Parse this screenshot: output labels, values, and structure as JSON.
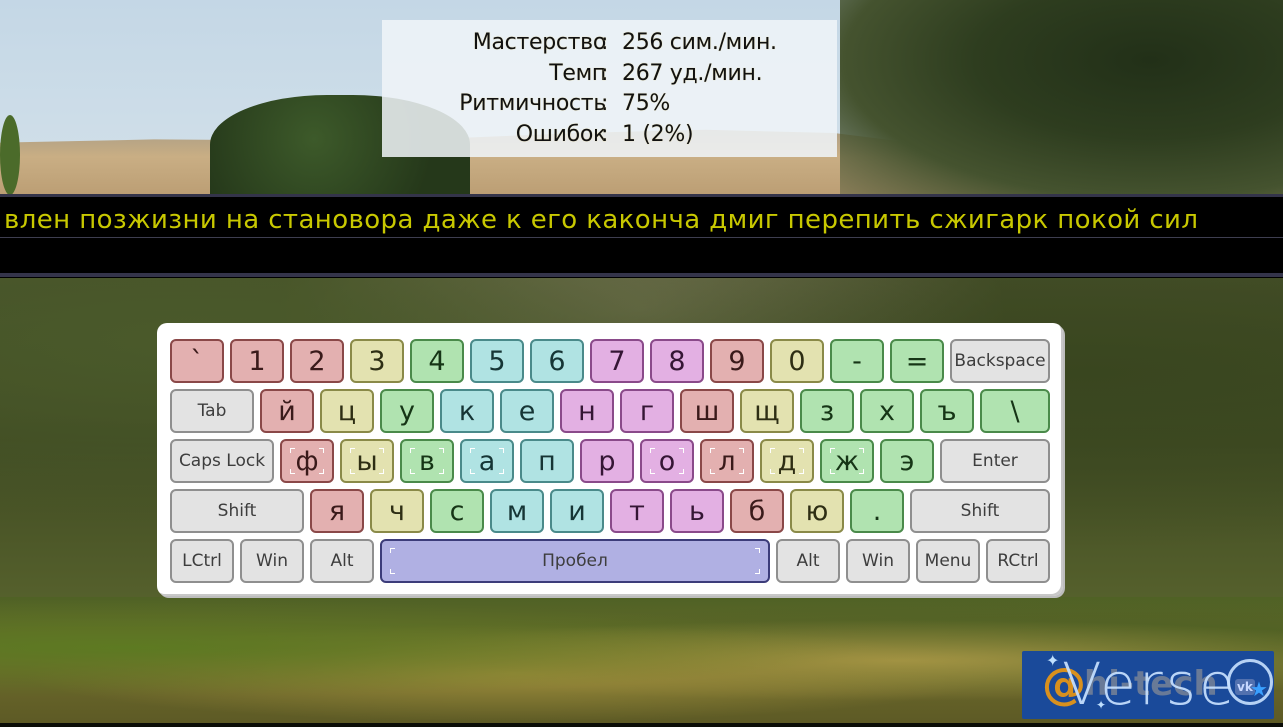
{
  "stats": [
    {
      "label": "Мастерство",
      "separator": ":",
      "value": "256 сим./мин."
    },
    {
      "label": "Темп",
      "separator": ":",
      "value": "267 уд./мин."
    },
    {
      "label": "Ритмичность",
      "separator": ":",
      "value": "75%"
    },
    {
      "label": "Ошибок",
      "separator": ":",
      "value": "1 (2%)"
    }
  ],
  "exercise": {
    "text": "влен позжизни на становора даже к его каконча дмиг перепить сжигарк покой сил",
    "typed": "",
    "text_color": "#c8c800"
  },
  "keyboard": {
    "rows": [
      [
        {
          "label": "`",
          "color": "red"
        },
        {
          "label": "1",
          "color": "red"
        },
        {
          "label": "2",
          "color": "red"
        },
        {
          "label": "3",
          "color": "yellow"
        },
        {
          "label": "4",
          "color": "green"
        },
        {
          "label": "5",
          "color": "cyan"
        },
        {
          "label": "6",
          "color": "cyan"
        },
        {
          "label": "7",
          "color": "purple"
        },
        {
          "label": "8",
          "color": "purple"
        },
        {
          "label": "9",
          "color": "red"
        },
        {
          "label": "0",
          "color": "yellow"
        },
        {
          "label": "-",
          "color": "green"
        },
        {
          "label": "=",
          "color": "green"
        },
        {
          "label": "Backspace",
          "color": "gray"
        }
      ],
      [
        {
          "label": "Tab",
          "color": "gray"
        },
        {
          "label": "й",
          "color": "red"
        },
        {
          "label": "ц",
          "color": "yellow"
        },
        {
          "label": "у",
          "color": "green"
        },
        {
          "label": "к",
          "color": "cyan"
        },
        {
          "label": "е",
          "color": "cyan"
        },
        {
          "label": "н",
          "color": "purple"
        },
        {
          "label": "г",
          "color": "purple"
        },
        {
          "label": "ш",
          "color": "red"
        },
        {
          "label": "щ",
          "color": "yellow"
        },
        {
          "label": "з",
          "color": "green"
        },
        {
          "label": "х",
          "color": "green"
        },
        {
          "label": "ъ",
          "color": "green"
        },
        {
          "label": "\\",
          "color": "green"
        }
      ],
      [
        {
          "label": "Caps Lock",
          "color": "gray"
        },
        {
          "label": "ф",
          "color": "red",
          "home": true
        },
        {
          "label": "ы",
          "color": "yellow",
          "home": true
        },
        {
          "label": "в",
          "color": "green",
          "home": true
        },
        {
          "label": "а",
          "color": "cyan",
          "home": true
        },
        {
          "label": "п",
          "color": "cyan"
        },
        {
          "label": "р",
          "color": "purple"
        },
        {
          "label": "о",
          "color": "purple",
          "home": true
        },
        {
          "label": "л",
          "color": "red",
          "home": true
        },
        {
          "label": "д",
          "color": "yellow",
          "home": true
        },
        {
          "label": "ж",
          "color": "green",
          "home": true
        },
        {
          "label": "э",
          "color": "green"
        },
        {
          "label": "Enter",
          "color": "gray"
        }
      ],
      [
        {
          "label": "Shift",
          "color": "gray"
        },
        {
          "label": "я",
          "color": "red"
        },
        {
          "label": "ч",
          "color": "yellow"
        },
        {
          "label": "с",
          "color": "green"
        },
        {
          "label": "м",
          "color": "cyan"
        },
        {
          "label": "и",
          "color": "cyan"
        },
        {
          "label": "т",
          "color": "purple"
        },
        {
          "label": "ь",
          "color": "purple"
        },
        {
          "label": "б",
          "color": "red"
        },
        {
          "label": "ю",
          "color": "yellow"
        },
        {
          "label": ".",
          "color": "green"
        },
        {
          "label": "Shift",
          "color": "gray"
        }
      ],
      [
        {
          "label": "LCtrl",
          "color": "gray"
        },
        {
          "label": "Win",
          "color": "gray"
        },
        {
          "label": "Alt",
          "color": "gray"
        },
        {
          "label": "Пробел",
          "color": "blue",
          "home": true
        },
        {
          "label": "Alt",
          "color": "gray"
        },
        {
          "label": "Win",
          "color": "gray"
        },
        {
          "label": "Menu",
          "color": "gray"
        },
        {
          "label": "RCtrl",
          "color": "gray"
        }
      ]
    ],
    "finger_colors": {
      "red": "#e3b0b0",
      "yellow": "#e3e2b0",
      "green": "#b0e3b0",
      "cyan": "#b0e3e3",
      "purple": "#e3b0e3",
      "gray": "#e3e3e3",
      "blue": "#b0b0e3"
    }
  },
  "logo": {
    "at": "@",
    "hitech": "hi-tech",
    "verse": "Verse",
    "vk": "vk"
  }
}
